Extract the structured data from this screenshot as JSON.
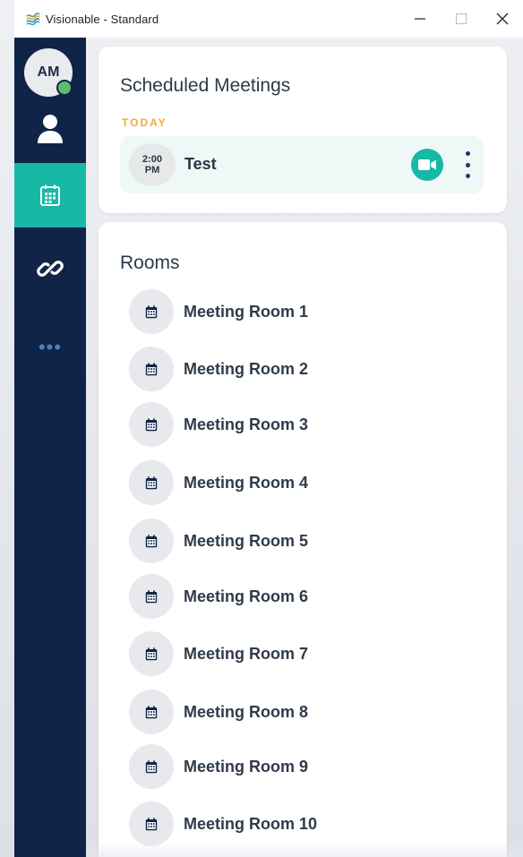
{
  "window": {
    "title": "Visionable - Standard",
    "logo_icon": "visionable-logo-icon",
    "controls": {
      "minimize": "minimize-icon",
      "maximize": "maximize-icon",
      "close": "close-icon"
    }
  },
  "sidebar": {
    "avatar_initials": "AM",
    "presence": "online",
    "items": [
      {
        "name": "contacts",
        "icon": "person-icon",
        "active": false
      },
      {
        "name": "meetings",
        "icon": "calendar-icon",
        "active": true
      },
      {
        "name": "links",
        "icon": "link-icon",
        "active": false
      },
      {
        "name": "more",
        "icon": "more-dots-icon",
        "label": "•••",
        "active": false
      }
    ]
  },
  "scheduled": {
    "title": "Scheduled Meetings",
    "day_label": "TODAY",
    "meetings": [
      {
        "time": "2:00",
        "meridiem": "PM",
        "title": "Test"
      }
    ]
  },
  "rooms": {
    "title": "Rooms",
    "items": [
      {
        "label": "Meeting Room 1"
      },
      {
        "label": "Meeting Room 2"
      },
      {
        "label": "Meeting Room 3"
      },
      {
        "label": "Meeting Room 4"
      },
      {
        "label": "Meeting Room 5"
      },
      {
        "label": "Meeting Room 6"
      },
      {
        "label": "Meeting Room 7"
      },
      {
        "label": "Meeting Room 8"
      },
      {
        "label": "Meeting Room 9"
      },
      {
        "label": "Meeting Room 10"
      }
    ]
  },
  "colors": {
    "sidebar_bg": "#0f2447",
    "accent_teal": "#17b8a6",
    "today_orange": "#f3a93a",
    "presence_green": "#5bc06b"
  }
}
